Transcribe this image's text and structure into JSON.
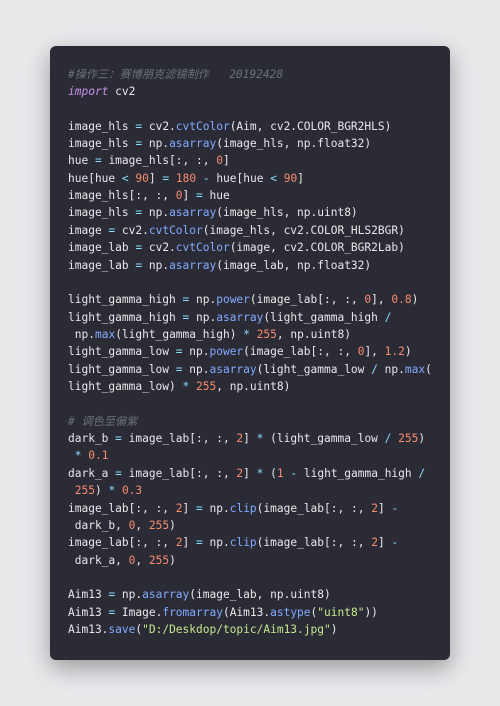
{
  "code": {
    "c1": "#操作三：赛博朋克滤镜制作   20192428",
    "kw_import": "import",
    "mod_cv2": "cv2",
    "l3a": "image_hls ",
    "l3b": "=",
    "l3c": " cv2.",
    "l3d": "cvtColor",
    "l3e": "(Aim, cv2.COLOR_BGR2HLS)",
    "l4a": "image_hls ",
    "l4b": "=",
    "l4c": " np.",
    "l4d": "asarray",
    "l4e": "(image_hls, np.float32)",
    "l5a": "hue ",
    "l5b": "=",
    "l5c": " image_hls[:, :, ",
    "l5d": "0",
    "l5e": "]",
    "l6a": "hue[hue ",
    "l6b": "<",
    "l6c": " ",
    "l6d": "90",
    "l6e": "] ",
    "l6f": "=",
    "l6g": " ",
    "l6h": "180",
    "l6i": " ",
    "l6j": "-",
    "l6k": " hue[hue ",
    "l6l": "<",
    "l6m": " ",
    "l6n": "90",
    "l6o": "]",
    "l7a": "image_hls[:, :, ",
    "l7b": "0",
    "l7c": "] ",
    "l7d": "=",
    "l7e": " hue",
    "l8a": "image_hls ",
    "l8b": "=",
    "l8c": " np.",
    "l8d": "asarray",
    "l8e": "(image_hls, np.uint8)",
    "l9a": "image ",
    "l9b": "=",
    "l9c": " cv2.",
    "l9d": "cvtColor",
    "l9e": "(image_hls, cv2.COLOR_HLS2BGR)",
    "l10a": "image_lab ",
    "l10b": "=",
    "l10c": " cv2.",
    "l10d": "cvtColor",
    "l10e": "(image, cv2.COLOR_BGR2Lab)",
    "l11a": "image_lab ",
    "l11b": "=",
    "l11c": " np.",
    "l11d": "asarray",
    "l11e": "(image_lab, np.float32)",
    "l12a": "light_gamma_high ",
    "l12b": "=",
    "l12c": " np.",
    "l12d": "power",
    "l12e": "(image_lab[:, :, ",
    "l12f": "0",
    "l12g": "], ",
    "l12h": "0.8",
    "l12i": ")",
    "l13a": "light_gamma_high ",
    "l13b": "=",
    "l13c": " np.",
    "l13d": "asarray",
    "l13e": "(light_gamma_high ",
    "l13f": "/",
    "l14a": " np.",
    "l14b": "max",
    "l14c": "(light_gamma_high) ",
    "l14d": "*",
    "l14e": " ",
    "l14f": "255",
    "l14g": ", np.uint8)",
    "l15a": "light_gamma_low ",
    "l15b": "=",
    "l15c": " np.",
    "l15d": "power",
    "l15e": "(image_lab[:, :, ",
    "l15f": "0",
    "l15g": "], ",
    "l15h": "1.2",
    "l15i": ")",
    "l16a": "light_gamma_low ",
    "l16b": "=",
    "l16c": " np.",
    "l16d": "asarray",
    "l16e": "(light_gamma_low ",
    "l16f": "/",
    "l16g": " np.",
    "l16h": "max",
    "l16i": "(",
    "l17a": "light_gamma_low) ",
    "l17b": "*",
    "l17c": " ",
    "l17d": "255",
    "l17e": ", np.uint8)",
    "c2": "# 调色至偏紫",
    "l18a": "dark_b ",
    "l18b": "=",
    "l18c": " image_lab[:, :, ",
    "l18d": "2",
    "l18e": "] ",
    "l18f": "*",
    "l18g": " (light_gamma_low ",
    "l18h": "/",
    "l18i": " ",
    "l18j": "255",
    "l18k": ")",
    "l19a": " ",
    "l19b": "*",
    "l19c": " ",
    "l19d": "0.1",
    "l20a": "dark_a ",
    "l20b": "=",
    "l20c": " image_lab[:, :, ",
    "l20d": "2",
    "l20e": "] ",
    "l20f": "*",
    "l20g": " (",
    "l20h": "1",
    "l20i": " ",
    "l20j": "-",
    "l20k": " light_gamma_high ",
    "l20l": "/",
    "l21a": " ",
    "l21b": "255",
    "l21c": ") ",
    "l21d": "*",
    "l21e": " ",
    "l21f": "0.3",
    "l22a": "image_lab[:, :, ",
    "l22b": "2",
    "l22c": "] ",
    "l22d": "=",
    "l22e": " np.",
    "l22f": "clip",
    "l22g": "(image_lab[:, :, ",
    "l22h": "2",
    "l22i": "] ",
    "l22j": "-",
    "l23a": " dark_b, ",
    "l23b": "0",
    "l23c": ", ",
    "l23d": "255",
    "l23e": ")",
    "l24a": "image_lab[:, :, ",
    "l24b": "2",
    "l24c": "] ",
    "l24d": "=",
    "l24e": " np.",
    "l24f": "clip",
    "l24g": "(image_lab[:, :, ",
    "l24h": "2",
    "l24i": "] ",
    "l24j": "-",
    "l25a": " dark_a, ",
    "l25b": "0",
    "l25c": ", ",
    "l25d": "255",
    "l25e": ")",
    "l26a": "Aim13 ",
    "l26b": "=",
    "l26c": " np.",
    "l26d": "asarray",
    "l26e": "(image_lab, np.uint8)",
    "l27a": "Aim13 ",
    "l27b": "=",
    "l27c": " Image.",
    "l27d": "fromarray",
    "l27e": "(Aim13.",
    "l27f": "astype",
    "l27g": "(",
    "l27h": "\"uint8\"",
    "l27i": "))",
    "l28a": "Aim13.",
    "l28b": "save",
    "l28c": "(",
    "l28d": "\"D:/Deskdop/topic/Aim13.jpg\"",
    "l28e": ")"
  }
}
